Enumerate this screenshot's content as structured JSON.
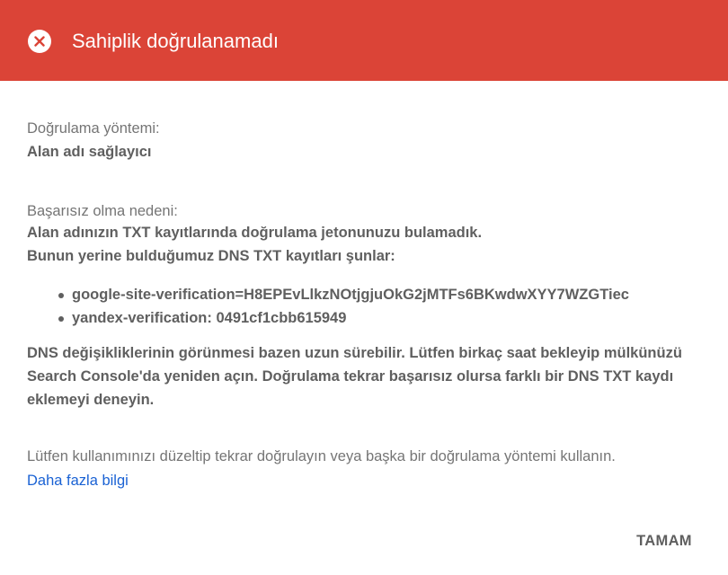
{
  "header": {
    "title": "Sahiplik doğrulanamadı",
    "icon": "close-circle-icon",
    "background_color": "#db4437"
  },
  "method": {
    "label": "Doğrulama yöntemi:",
    "value": "Alan adı sağlayıcı"
  },
  "failure": {
    "label": "Başarısız olma nedeni:",
    "line1": "Alan adınızın TXT kayıtlarında doğrulama jetonunuzu bulamadık.",
    "line2": "Bunun yerine bulduğumuz DNS TXT kayıtları şunlar:",
    "records": [
      "google-site-verification=H8EPEvLlkzNOtjgjuOkG2jMTFs6BKwdwXYY7WZGTiec",
      "yandex-verification: 0491cf1cbb615949"
    ]
  },
  "advice": "DNS değişikliklerinin görünmesi bazen uzun sürebilir. Lütfen birkaç saat bekleyip mülkünüzü Search Console'da yeniden açın. Doğrulama tekrar başarısız olursa farklı bir DNS TXT kaydı eklemeyi deneyin.",
  "footer_note": "Lütfen kullanımınızı düzeltip tekrar doğrulayın veya başka bir doğrulama yöntemi kullanın.",
  "learn_more_link": "Daha fazla bilgi",
  "ok_button": "TAMAM",
  "colors": {
    "link": "#1a62d4",
    "text": "#5f5f5f"
  }
}
